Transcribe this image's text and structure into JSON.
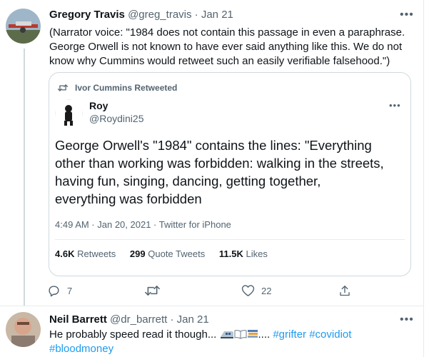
{
  "tweet1": {
    "name": "Gregory Travis",
    "handle": "@greg_travis",
    "time": "Jan 21",
    "text_lines": [
      "(Narrator voice: \"1984 does not contain this passage in even a paraphrase.",
      "George Orwell is not known to have ever said anything like this.  We do not",
      "know why Cummins would retweet such an easily verifiable falsehood.\")"
    ],
    "quote": {
      "retweeted_by": "Ivor Cummins Retweeted",
      "name": "Roy",
      "handle": "@Roydini25",
      "text_lines": [
        "George Orwell's \"1984\" contains the lines: \"Everything",
        "other than working was forbidden: walking in the streets,",
        "having fun, singing, dancing, getting together,",
        "everything was forbidden"
      ],
      "meta": "4:49 AM · Jan 20, 2021 · Twitter for iPhone",
      "stats": {
        "retweets_count": "4.6K",
        "retweets_label": "Retweets",
        "quotes_count": "299",
        "quotes_label": "Quote Tweets",
        "likes_count": "11.5K",
        "likes_label": "Likes"
      }
    },
    "actions": {
      "reply_count": "7",
      "retweet_count": "",
      "like_count": "22"
    }
  },
  "tweet2": {
    "name": "Neil Barrett",
    "handle": "@dr_barrett",
    "time": "Jan 21",
    "text_prefix": "He probably speed read it though...",
    "text_ellipsis": "....",
    "hashtags": [
      "#grifter",
      "#covidiot",
      "#bloodmoney"
    ]
  },
  "colors": {
    "accent": "#1d9bf0",
    "muted": "#536471",
    "border": "#cfd9de"
  },
  "icons": [
    "more-icon",
    "retweet-icon",
    "reply-icon",
    "like-icon",
    "share-icon",
    "train-emoji-icon",
    "book-emoji-icon",
    "books-emoji-icon"
  ]
}
